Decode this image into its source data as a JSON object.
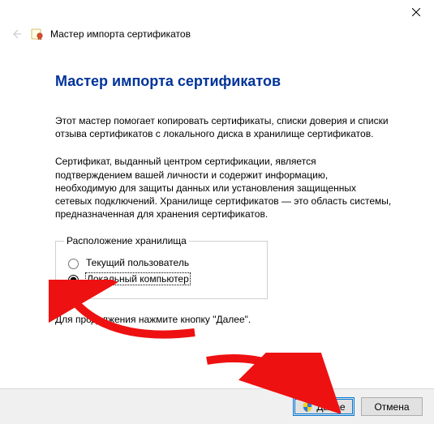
{
  "window": {
    "header_title": "Мастер импорта сертификатов"
  },
  "main": {
    "heading": "Мастер импорта сертификатов",
    "intro": "Этот мастер помогает копировать сертификаты, списки доверия и списки отзыва сертификатов с локального диска в хранилище сертификатов.",
    "explain": "Сертификат, выданный центром сертификации, является подтверждением вашей личности и содержит информацию, необходимую для защиты данных или установления защищенных сетевых подключений. Хранилище сертификатов — это область системы, предназначенная для хранения сертификатов.",
    "group_legend": "Расположение хранилища",
    "radio_current_user": "Текущий пользователь",
    "radio_local_computer": "Локальный компьютер",
    "selected_option": "local_computer",
    "continue_hint": "Для продолжения нажмите кнопку \"Далее\"."
  },
  "footer": {
    "next_label": "Далее",
    "cancel_label": "Отмена"
  },
  "icons": {
    "close": "close-icon",
    "back": "back-arrow-icon",
    "cert": "certificate-wizard-icon",
    "shield": "uac-shield-icon"
  }
}
